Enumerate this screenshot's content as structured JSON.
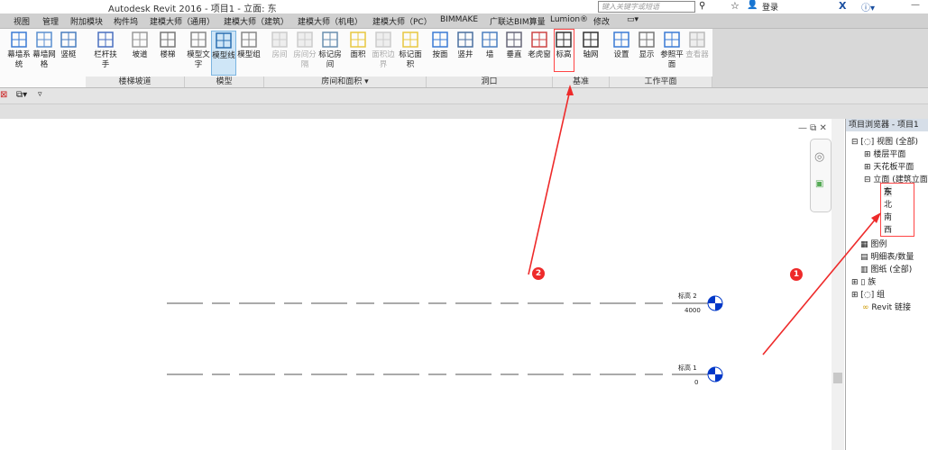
{
  "title": "Autodesk Revit 2016 -     项目1 - 立面: 东",
  "search_placeholder": "键入关键字或短语",
  "login": "登录",
  "menu": [
    "视图",
    "管理",
    "附加模块",
    "构件坞",
    "建模大师（通用）",
    "建模大师（建筑）",
    "建模大师（机电）",
    "建模大师（PC）",
    "BIMMAKE",
    "广联达BIM算量",
    "Lumion®",
    "修改",
    "▭▾"
  ],
  "ribbon": {
    "buttons": [
      "幕墙系统",
      "幕墙网格",
      "竖梃",
      "栏杆扶手",
      "坡道",
      "楼梯",
      "模型文字",
      "模型线",
      "模型组",
      "房间",
      "房间分隔",
      "标记房间",
      "面积",
      "面积边界",
      "标记面积",
      "按面",
      "竖井",
      "墙",
      "垂直",
      "老虎窗",
      "标高",
      "轴网",
      "设置",
      "显示",
      "参照平面",
      "查看器"
    ],
    "panels": [
      "楼梯坡道",
      "模型",
      "房间和面积 ▾",
      "洞口",
      "基准",
      "工作平面"
    ]
  },
  "levels": [
    {
      "name": "标高 2",
      "elevation": "4000"
    },
    {
      "name": "标高 1",
      "elevation": "0"
    }
  ],
  "browser": {
    "title": "项目浏览器 - 项目1",
    "items": [
      "视图 (全部)",
      "楼层平面",
      "天花板平面",
      "立面 (建筑立面)",
      "东",
      "北",
      "南",
      "西",
      "图例",
      "明细表/数量",
      "图纸 (全部)",
      "族",
      "组",
      "Revit 链接"
    ]
  },
  "annotations": [
    "1",
    "2"
  ],
  "colors": {
    "accent_red": "#ee2a2a",
    "level_blue": "#0038c8",
    "selected": "#cfe6f7"
  }
}
